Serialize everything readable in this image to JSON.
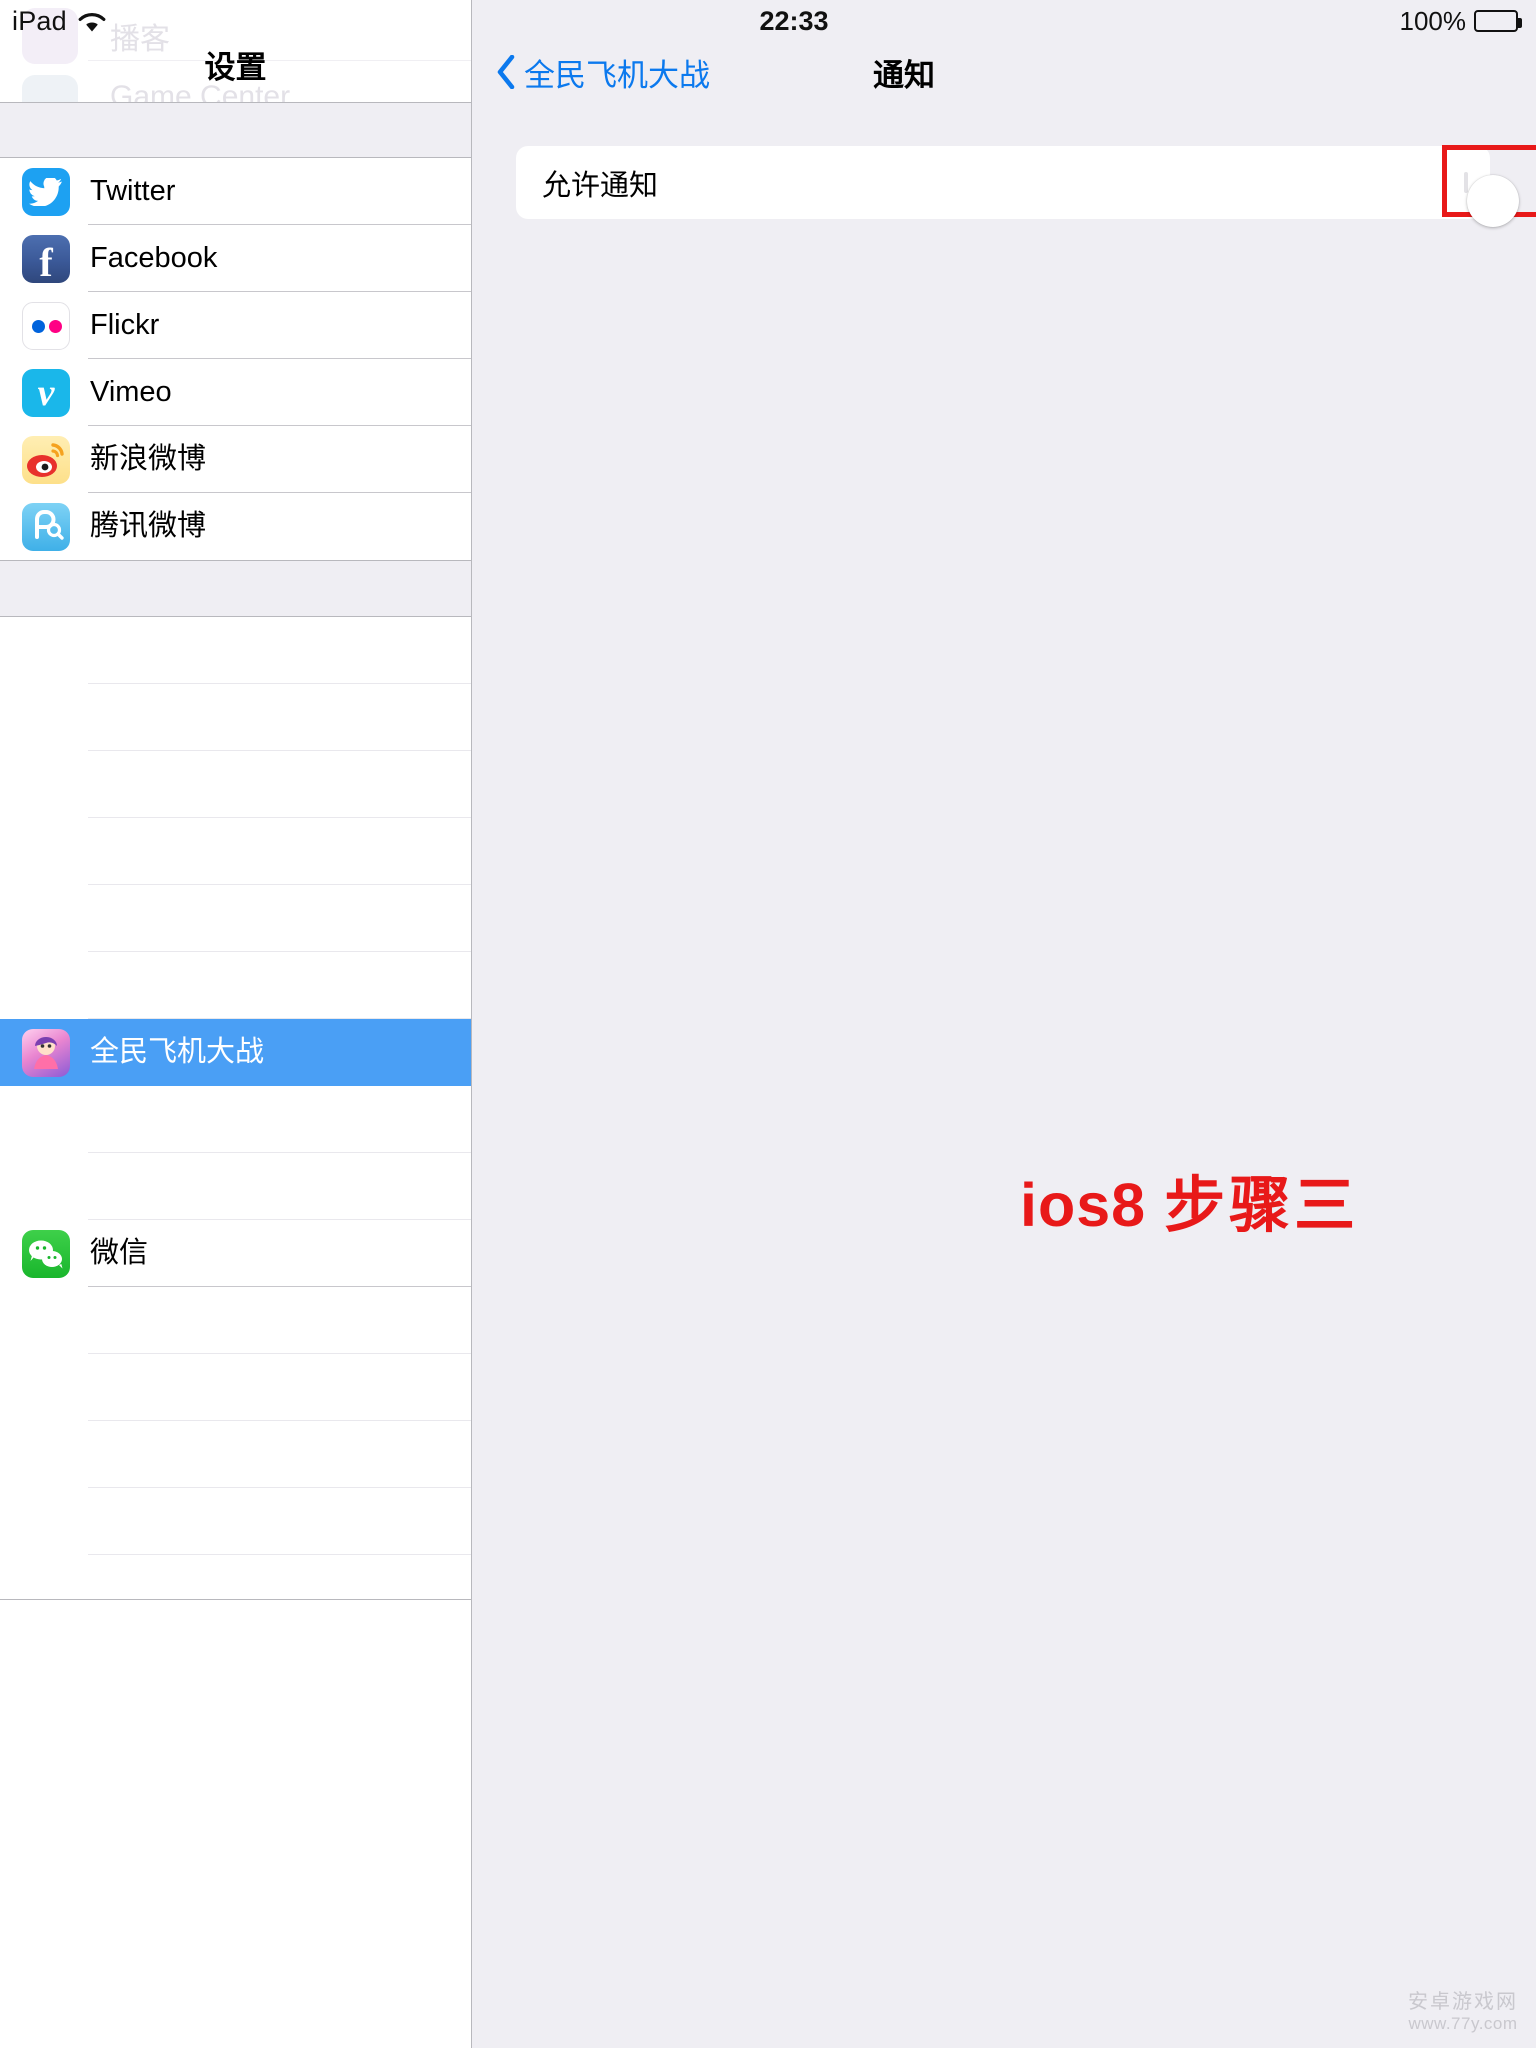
{
  "status_bar": {
    "device_label": "iPad",
    "wifi_icon": "wifi-icon",
    "time": "22:33",
    "battery_percent": "100%",
    "battery_icon": "battery-full-icon"
  },
  "sidebar": {
    "title": "设置",
    "ghost_rows": [
      {
        "label": "播客"
      },
      {
        "label": "Game Center"
      }
    ],
    "sections": [
      {
        "items": [
          {
            "label": "Twitter",
            "icon": "twitter-icon",
            "color": "#1DA1F2",
            "glyph": "🐦"
          },
          {
            "label": "Facebook",
            "icon": "facebook-icon",
            "color": "#3b5998",
            "glyph": "f"
          },
          {
            "label": "Flickr",
            "icon": "flickr-icon",
            "color": "#ffffff",
            "glyph": ""
          },
          {
            "label": "Vimeo",
            "icon": "vimeo-icon",
            "color": "#1ab7ea",
            "glyph": "v"
          },
          {
            "label": "新浪微博",
            "icon": "sina-weibo-icon",
            "color": "#fde08a",
            "glyph": ""
          },
          {
            "label": "腾讯微博",
            "icon": "tencent-weibo-icon",
            "color": "#3fb0e8",
            "glyph": ""
          }
        ]
      },
      {
        "items": [
          {
            "label": "",
            "icon": "app-icon",
            "faded": true
          },
          {
            "label": "",
            "icon": "app-icon",
            "faded": true
          },
          {
            "label": "",
            "icon": "app-icon",
            "faded": true
          },
          {
            "label": "",
            "icon": "app-icon",
            "faded": true
          },
          {
            "label": "",
            "icon": "app-icon",
            "faded": true
          },
          {
            "label": "",
            "icon": "app-icon",
            "faded": true
          },
          {
            "label": "全民飞机大战",
            "icon": "game-app-icon",
            "selected": true
          },
          {
            "label": "",
            "icon": "app-icon",
            "faded": true
          },
          {
            "label": "",
            "icon": "app-icon",
            "faded": true
          },
          {
            "label": "微信",
            "icon": "wechat-icon",
            "color": "#19b62c",
            "glyph": ""
          },
          {
            "label": "",
            "icon": "app-icon",
            "faded": true
          },
          {
            "label": "",
            "icon": "app-icon",
            "faded": true
          },
          {
            "label": "",
            "icon": "app-icon",
            "faded": true
          },
          {
            "label": "",
            "icon": "app-icon",
            "faded": true
          }
        ]
      }
    ]
  },
  "detail": {
    "back_label": "全民飞机大战",
    "back_icon": "chevron-left-icon",
    "title": "通知",
    "allow_notifications": {
      "label": "允许通知",
      "toggle_state": "off",
      "highlight_color": "#e81919"
    }
  },
  "annotation": {
    "step_text_en": "ios8",
    "step_text_cn": "步骤三",
    "color": "#e81919"
  },
  "watermark": {
    "line1": "安卓游戏网",
    "line2": "www.77y.com"
  }
}
